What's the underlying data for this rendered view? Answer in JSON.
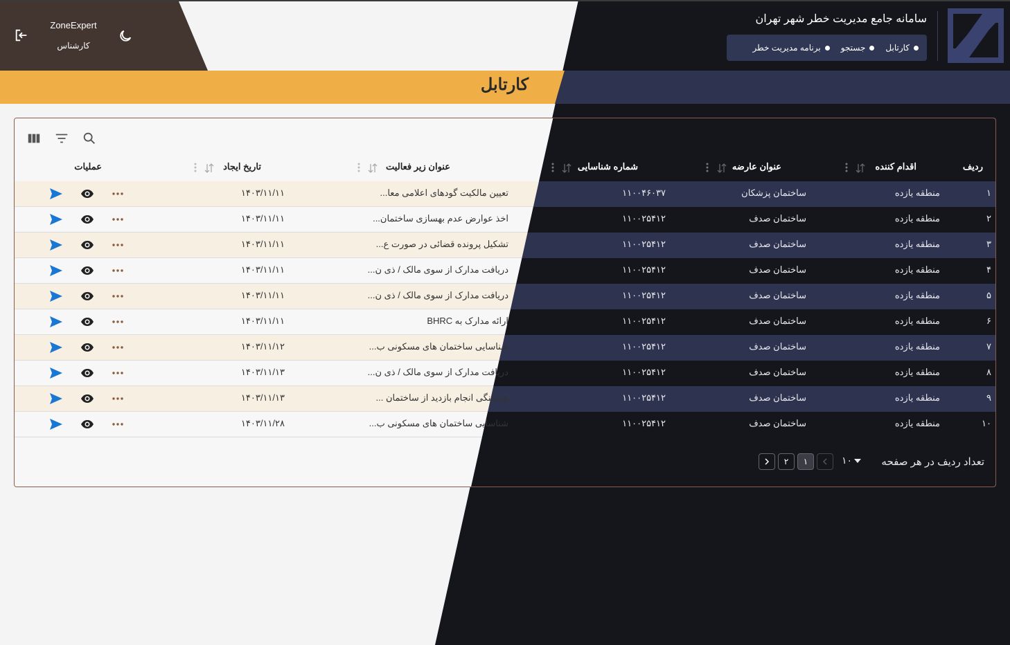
{
  "header": {
    "user_name": "ZoneExpert",
    "user_role": "کارشناس",
    "app_title": "سامانه جامع مدیریت خطر شهر تهران",
    "nav": [
      "کارتابل",
      "جستجو",
      "برنامه مدیریت خطر"
    ]
  },
  "page": {
    "title": "کارتابل"
  },
  "table": {
    "columns": {
      "row": "ردیف",
      "actor": "اقدام کننده",
      "exposure": "عنوان عارضه",
      "id": "شماره شناسایی",
      "subactivity": "عنوان زیر فعالیت",
      "created": "تاریخ ایجاد",
      "ops": "عملیات"
    },
    "rows": [
      {
        "n": "۱",
        "actor": "منطقه یازده",
        "exposure": "ساختمان پزشکان",
        "id": "۱۱۰۰۴۶۰۳۷",
        "sub": "تعیین مالکیت گودهای اعلامی معا...",
        "date": "۱۴۰۳/۱۱/۱۱"
      },
      {
        "n": "۲",
        "actor": "منطقه یازده",
        "exposure": "ساختمان صدف",
        "id": "۱۱۰۰۲۵۴۱۲",
        "sub": "اخذ عوارض عدم بهسازی ساختمان...",
        "date": "۱۴۰۳/۱۱/۱۱"
      },
      {
        "n": "۳",
        "actor": "منطقه یازده",
        "exposure": "ساختمان صدف",
        "id": "۱۱۰۰۲۵۴۱۲",
        "sub": "تشکیل پرونده قضائی در صورت ع...",
        "date": "۱۴۰۳/۱۱/۱۱"
      },
      {
        "n": "۴",
        "actor": "منطقه یازده",
        "exposure": "ساختمان صدف",
        "id": "۱۱۰۰۲۵۴۱۲",
        "sub": "دریافت مدارک از سوی مالک / ذی ن...",
        "date": "۱۴۰۳/۱۱/۱۱"
      },
      {
        "n": "۵",
        "actor": "منطقه یازده",
        "exposure": "ساختمان صدف",
        "id": "۱۱۰۰۲۵۴۱۲",
        "sub": "دریافت مدارک از سوی مالک / ذی ن...",
        "date": "۱۴۰۳/۱۱/۱۱"
      },
      {
        "n": "۶",
        "actor": "منطقه یازده",
        "exposure": "ساختمان صدف",
        "id": "۱۱۰۰۲۵۴۱۲",
        "sub": "ارائه مدارک به BHRC",
        "date": "۱۴۰۳/۱۱/۱۱"
      },
      {
        "n": "۷",
        "actor": "منطقه یازده",
        "exposure": "ساختمان صدف",
        "id": "۱۱۰۰۲۵۴۱۲",
        "sub": "شناسایی ساختمان های مسکونی ب...",
        "date": "۱۴۰۳/۱۱/۱۲"
      },
      {
        "n": "۸",
        "actor": "منطقه یازده",
        "exposure": "ساختمان صدف",
        "id": "۱۱۰۰۲۵۴۱۲",
        "sub": "دریافت مدارک از سوی مالک / ذی ن...",
        "date": "۱۴۰۳/۱۱/۱۳"
      },
      {
        "n": "۹",
        "actor": "منطقه یازده",
        "exposure": "ساختمان صدف",
        "id": "۱۱۰۰۲۵۴۱۲",
        "sub": "هماهنگی انجام بازدید از ساختمان ...",
        "date": "۱۴۰۳/۱۱/۱۳"
      },
      {
        "n": "۱۰",
        "actor": "منطقه یازده",
        "exposure": "ساختمان صدف",
        "id": "۱۱۰۰۲۵۴۱۲",
        "sub": "شناسایی ساختمان های مسکونی ب...",
        "date": "۱۴۰۳/۱۱/۲۸"
      }
    ]
  },
  "pagination": {
    "label": "تعداد ردیف در هر صفحه",
    "page_size": "۱۰",
    "pages": [
      "۱",
      "۲"
    ],
    "current_page": "۱"
  },
  "colors": {
    "header_left": "#433631",
    "dark_bg": "#15161c",
    "navy": "#303754",
    "orange": "#efae46",
    "stripe_light": "#f8efe3",
    "stripe_dark": "#2e3450",
    "send_blue": "#1976d2",
    "dots_brown": "#8a5a3c"
  },
  "icons": [
    "logout-icon",
    "moon-icon",
    "logo-icon",
    "columns-icon",
    "filter-icon",
    "search-icon",
    "sort-icon",
    "kebab-icon",
    "send-icon",
    "eye-icon",
    "more-icon",
    "chevron-left-icon",
    "chevron-right-icon",
    "caret-down-icon"
  ]
}
